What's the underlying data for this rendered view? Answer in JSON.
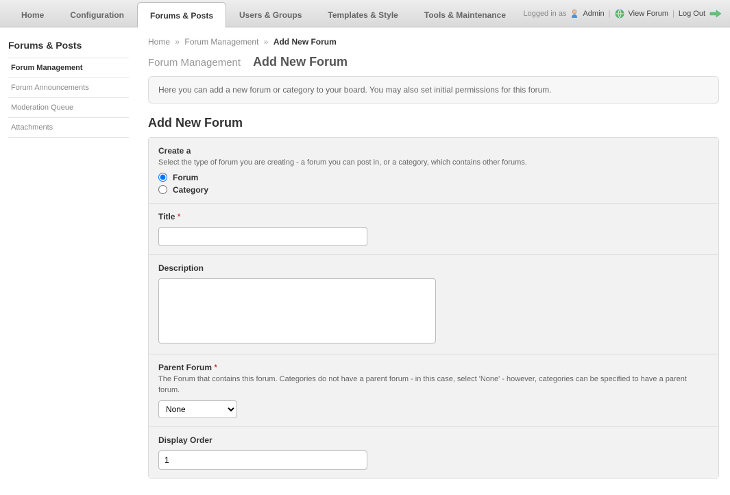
{
  "top_tabs": [
    {
      "label": "Home"
    },
    {
      "label": "Configuration"
    },
    {
      "label": "Forums & Posts"
    },
    {
      "label": "Users & Groups"
    },
    {
      "label": "Templates & Style"
    },
    {
      "label": "Tools & Maintenance"
    }
  ],
  "top_right": {
    "logged_in_as": "Logged in as",
    "username": "Admin",
    "view_forum": "View Forum",
    "log_out": "Log Out"
  },
  "sidebar": {
    "title": "Forums & Posts",
    "items": [
      {
        "label": "Forum Management"
      },
      {
        "label": "Forum Announcements"
      },
      {
        "label": "Moderation Queue"
      },
      {
        "label": "Attachments"
      }
    ]
  },
  "breadcrumb": {
    "items": [
      "Home",
      "Forum Management",
      "Add New Forum"
    ]
  },
  "page_heading": {
    "sub": "Forum Management",
    "main": "Add New Forum"
  },
  "intro": "Here you can add a new forum or category to your board. You may also set initial permissions for this forum.",
  "section_title": "Add New Forum",
  "form": {
    "create_a": {
      "label": "Create a",
      "hint": "Select the type of forum you are creating - a forum you can post in, or a category, which contains other forums.",
      "option_forum": "Forum",
      "option_category": "Category"
    },
    "title": {
      "label": "Title",
      "required": "*",
      "value": ""
    },
    "description": {
      "label": "Description",
      "value": ""
    },
    "parent_forum": {
      "label": "Parent Forum",
      "required": "*",
      "hint": "The Forum that contains this forum. Categories do not have a parent forum - in this case, select 'None' - however, categories can be specified to have a parent forum.",
      "selected": "None"
    },
    "display_order": {
      "label": "Display Order",
      "value": "1"
    }
  }
}
